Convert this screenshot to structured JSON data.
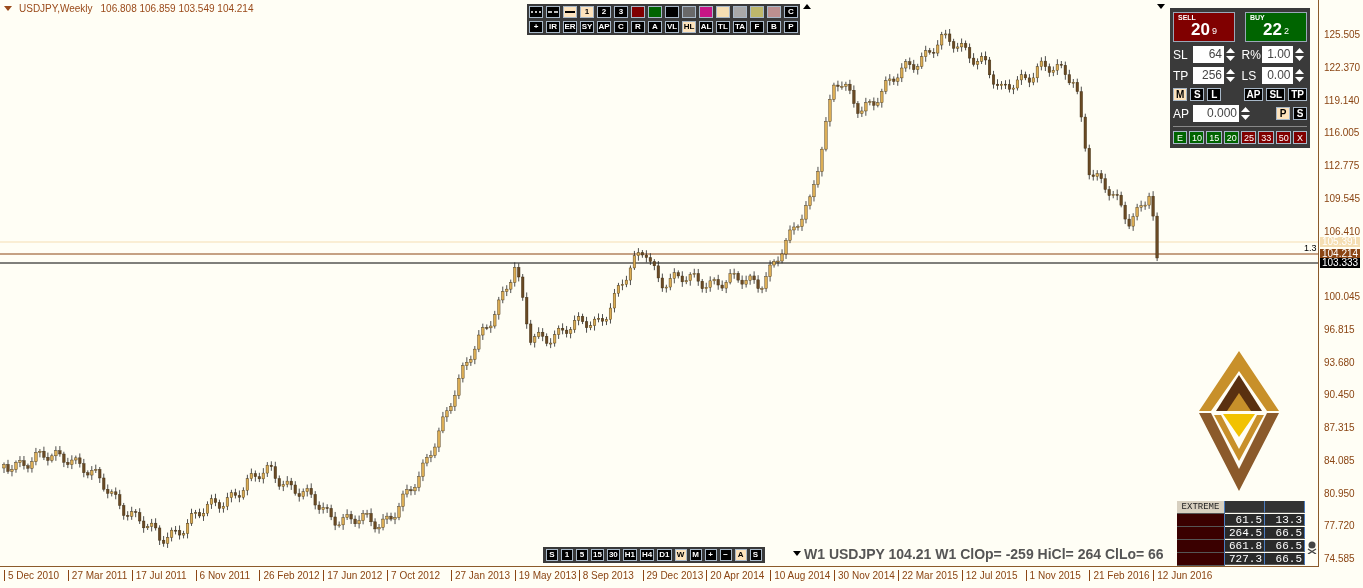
{
  "header": {
    "symbol": "USDJPY,Weekly",
    "ohlc": "106.808 106.859 103.549 104.214"
  },
  "drawing_toolbar": {
    "styles": [
      {
        "kind": "dotted",
        "selected": false
      },
      {
        "kind": "dashed",
        "selected": false
      },
      {
        "kind": "solid",
        "selected": true
      }
    ],
    "widths": [
      {
        "label": "1",
        "selected": true
      },
      {
        "label": "2",
        "selected": false
      },
      {
        "label": "3",
        "selected": false
      }
    ],
    "colors": [
      {
        "color": "#800000"
      },
      {
        "color": "#006400"
      },
      {
        "color": "#000000"
      },
      {
        "color": "#696969"
      },
      {
        "color": "#c71585"
      },
      {
        "color": "#f5deb3"
      },
      {
        "color": "#a9a9a9"
      },
      {
        "color": "#bdb76b"
      },
      {
        "color": "#bc8f8f"
      }
    ],
    "clear": "C",
    "tools": [
      {
        "label": "+",
        "selected": false
      },
      {
        "label": "IR",
        "selected": false
      },
      {
        "label": "ER",
        "selected": false
      },
      {
        "label": "SY",
        "selected": false
      },
      {
        "label": "AP",
        "selected": false
      },
      {
        "label": "C",
        "selected": false
      },
      {
        "label": "R",
        "selected": false
      },
      {
        "label": "A",
        "selected": false
      },
      {
        "label": "VL",
        "selected": false
      },
      {
        "label": "HL",
        "selected": true
      },
      {
        "label": "AL",
        "selected": false
      },
      {
        "label": "TL",
        "selected": false
      },
      {
        "label": "TA",
        "selected": false
      },
      {
        "label": "F",
        "selected": false
      },
      {
        "label": "B",
        "selected": false
      },
      {
        "label": "P",
        "selected": false
      }
    ]
  },
  "trade_panel": {
    "sell": {
      "label": "SELL",
      "price": "20",
      "pip": "9"
    },
    "buy": {
      "label": "BUY",
      "price": "22",
      "pip": "2"
    },
    "fields": [
      {
        "label": "SL",
        "value": "64"
      },
      {
        "label": "R%",
        "value": "1.00"
      },
      {
        "label": "TP",
        "value": "256"
      },
      {
        "label": "LS",
        "value": "0.00"
      }
    ],
    "mode_buttons": [
      {
        "label": "M",
        "selected": true
      },
      {
        "label": "S",
        "selected": false
      },
      {
        "label": "L",
        "selected": false
      }
    ],
    "line_buttons": [
      {
        "label": "AP",
        "selected": false
      },
      {
        "label": "SL",
        "selected": false
      },
      {
        "label": "TP",
        "selected": false
      }
    ],
    "ap_field": {
      "label": "AP",
      "value": "0.000"
    },
    "ap_buttons": [
      {
        "label": "P",
        "selected": true
      },
      {
        "label": "S",
        "selected": false
      }
    ],
    "close_buttons": [
      {
        "label": "E",
        "color": "#006400"
      },
      {
        "label": "10",
        "color": "#006400"
      },
      {
        "label": "15",
        "color": "#006400"
      },
      {
        "label": "20",
        "color": "#006400"
      },
      {
        "label": "25",
        "color": "#800000"
      },
      {
        "label": "33",
        "color": "#800000"
      },
      {
        "label": "50",
        "color": "#800000"
      },
      {
        "label": "X",
        "color": "#800000"
      }
    ]
  },
  "price_levels": [
    {
      "label": "105.391",
      "color": "#f5deb3"
    },
    {
      "label": "104.214",
      "color": "#8b4513"
    },
    {
      "label": "103.333",
      "color": "#000000"
    }
  ],
  "level_note": "1.3",
  "timeframes": [
    {
      "label": "S",
      "selected": false
    },
    {
      "label": "1",
      "selected": false
    },
    {
      "label": "5",
      "selected": false
    },
    {
      "label": "15",
      "selected": false
    },
    {
      "label": "30",
      "selected": false
    },
    {
      "label": "H1",
      "selected": false
    },
    {
      "label": "H4",
      "selected": false
    },
    {
      "label": "D1",
      "selected": false
    },
    {
      "label": "W",
      "selected": true
    },
    {
      "label": "M",
      "selected": false
    },
    {
      "label": "+",
      "selected": false
    },
    {
      "label": "−",
      "selected": false
    },
    {
      "label": "A",
      "selected": true
    },
    {
      "label": "S",
      "selected": false
    }
  ],
  "status_text": "W1 USDJPY 104.21 W1 ClOp= -259 HiCl= 264 ClLo= 66",
  "extreme": {
    "title": "EXTREME",
    "rows": [
      [
        "61.5",
        "13.3"
      ],
      [
        "264.5",
        "66.5"
      ],
      [
        "661.8",
        "66.5"
      ],
      [
        "727.3",
        "66.5"
      ]
    ]
  },
  "price_axis": [
    "125.505",
    "122.370",
    "119.140",
    "116.005",
    "112.775",
    "109.545",
    "106.410",
    "100.045",
    "96.815",
    "93.680",
    "90.450",
    "87.315",
    "84.085",
    "80.950",
    "77.720",
    "74.585"
  ],
  "time_axis": [
    "5 Dec 2010",
    "27 Mar 2011",
    "17 Jul 2011",
    "6 Nov 2011",
    "26 Feb 2012",
    "17 Jun 2012",
    "7 Oct 2012",
    "27 Jan 2013",
    "19 May 2013",
    "8 Sep 2013",
    "29 Dec 2013",
    "20 Apr 2014",
    "10 Aug 2014",
    "30 Nov 2014",
    "22 Mar 2015",
    "12 Jul 2015",
    "1 Nov 2015",
    "21 Feb 2016",
    "12 Jun 2016"
  ]
}
